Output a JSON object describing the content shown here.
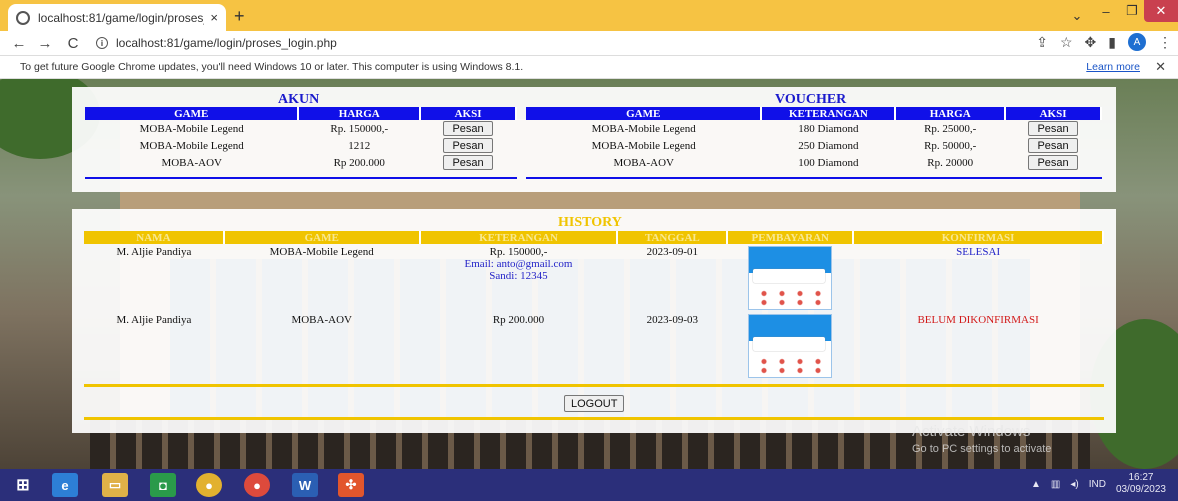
{
  "browser": {
    "tab_title": "localhost:81/game/login/proses_",
    "tab_close": "×",
    "new_tab": "+",
    "url": "localhost:81/game/login/proses_login.php",
    "window_controls": {
      "chevron": "⌄",
      "minimize": "–",
      "maximize": "❐",
      "close": "✕"
    },
    "profile_initial": "A"
  },
  "infobar": {
    "message": "To get future Google Chrome updates, you'll need Windows 10 or later. This computer is using Windows 8.1.",
    "link": "Learn more",
    "close": "✕"
  },
  "akun": {
    "title": "AKUN",
    "headers": [
      "GAME",
      "HARGA",
      "AKSI"
    ],
    "rows": [
      {
        "game": "MOBA-Mobile Legend",
        "harga": "Rp. 150000,-",
        "aksi": "Pesan"
      },
      {
        "game": "MOBA-Mobile Legend",
        "harga": "1212",
        "aksi": "Pesan"
      },
      {
        "game": "MOBA-AOV",
        "harga": "Rp 200.000",
        "aksi": "Pesan"
      }
    ]
  },
  "voucher": {
    "title": "VOUCHER",
    "headers": [
      "GAME",
      "KETERANGAN",
      "HARGA",
      "AKSI"
    ],
    "rows": [
      {
        "game": "MOBA-Mobile Legend",
        "keterangan": "180 Diamond",
        "harga": "Rp. 25000,-",
        "aksi": "Pesan"
      },
      {
        "game": "MOBA-Mobile Legend",
        "keterangan": "250 Diamond",
        "harga": "Rp. 50000,-",
        "aksi": "Pesan"
      },
      {
        "game": "MOBA-AOV",
        "keterangan": "100 Diamond",
        "harga": "Rp. 20000",
        "aksi": "Pesan"
      }
    ]
  },
  "history": {
    "title": "HISTORY",
    "headers": [
      "NAMA",
      "GAME",
      "KETERANGAN",
      "TANGGAL",
      "PEMBAYARAN",
      "KONFIRMASI"
    ],
    "rows": [
      {
        "nama": "M. Aljie Pandiya",
        "game": "MOBA-Mobile Legend",
        "keterangan": [
          "Rp. 150000,-",
          "Email: anto@gmail.com",
          "Sandi: 12345"
        ],
        "tanggal": "2023-09-01",
        "konfirmasi": "SELESAI"
      },
      {
        "nama": "M. Aljie Pandiya",
        "game": "MOBA-AOV",
        "keterangan": [
          "Rp 200.000"
        ],
        "tanggal": "2023-09-03",
        "konfirmasi": "BELUM DIKONFIRMASI"
      }
    ],
    "logout": "LOGOUT"
  },
  "watermark": {
    "line1": "Activate Windows",
    "line2": "Go to PC settings to activate"
  },
  "taskbar": {
    "lang": "IND",
    "time": "16:27",
    "date": "03/09/2023"
  },
  "colors": {
    "tab_strip": "#f6c343",
    "akun_header": "#1010e8",
    "history_header": "#f0c400",
    "status_done": "#2424c8",
    "status_pending": "#d21a1a",
    "taskbar": "#2b2f7a"
  }
}
